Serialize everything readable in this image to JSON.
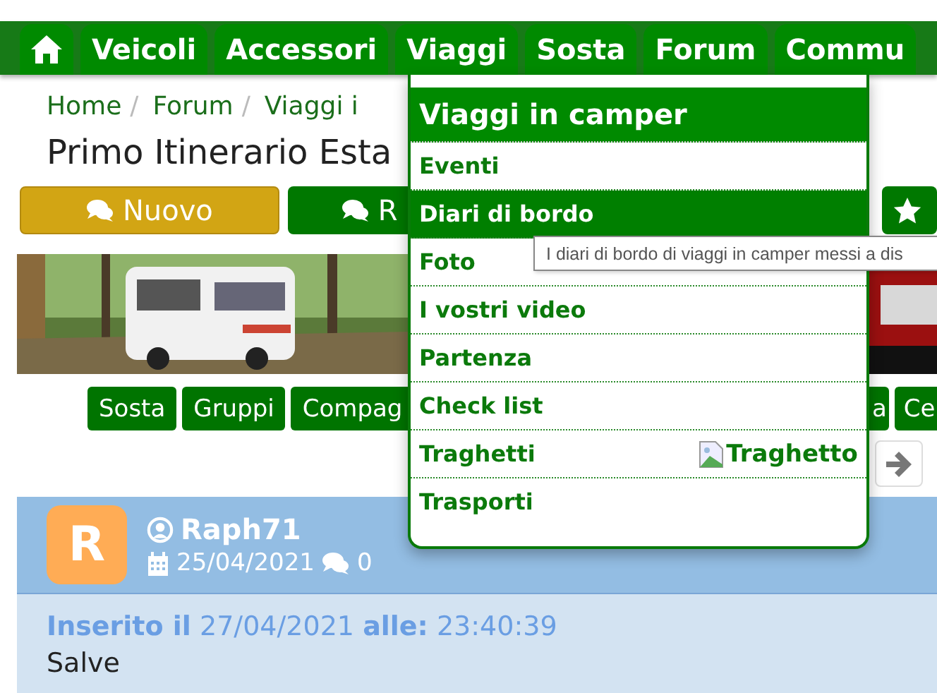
{
  "nav": {
    "items": [
      {
        "label": "Veicoli"
      },
      {
        "label": "Accessori"
      },
      {
        "label": "Viaggi"
      },
      {
        "label": "Sosta"
      },
      {
        "label": "Forum"
      },
      {
        "label": "Commu"
      }
    ]
  },
  "breadcrumb": [
    {
      "kind": "link",
      "label": "Home"
    },
    {
      "kind": "separator",
      "label": "/"
    },
    {
      "kind": "link",
      "label": "Forum"
    },
    {
      "kind": "separator",
      "label": "/"
    },
    {
      "kind": "link",
      "label": "Viaggi i"
    }
  ],
  "title": "Primo Itinerario Esta",
  "actions": [
    {
      "kind": "new",
      "label": "Nuovo"
    },
    {
      "kind": "reply",
      "label": "R"
    },
    {
      "kind": "star"
    }
  ],
  "tags": [
    "Sosta",
    "Gruppi",
    "Compag",
    "a",
    "Ce"
  ],
  "post": {
    "avatar_letter": "R",
    "author": "Raph71",
    "date": "25/04/2021",
    "comments": "0",
    "posted_label": "Inserito il",
    "posted_date": "27/04/2021",
    "time_label": "alle:",
    "posted_time": "23:40:39",
    "text": "Salve"
  },
  "menu": {
    "title": "Viaggi in camper",
    "items": [
      {
        "label": "Eventi",
        "selected": false
      },
      {
        "label": "Diari di bordo",
        "selected": true
      },
      {
        "label": "Foto",
        "selected": false
      },
      {
        "label": "I vostri video",
        "selected": false
      },
      {
        "label": "Partenza",
        "selected": false
      },
      {
        "label": "Check list",
        "selected": false
      },
      {
        "label": "Traghetti",
        "selected": false,
        "image_alt": "Traghetto"
      },
      {
        "label": "Trasporti",
        "selected": false
      }
    ]
  },
  "tooltip": "I diari di bordo di viaggi in camper messi a dis"
}
